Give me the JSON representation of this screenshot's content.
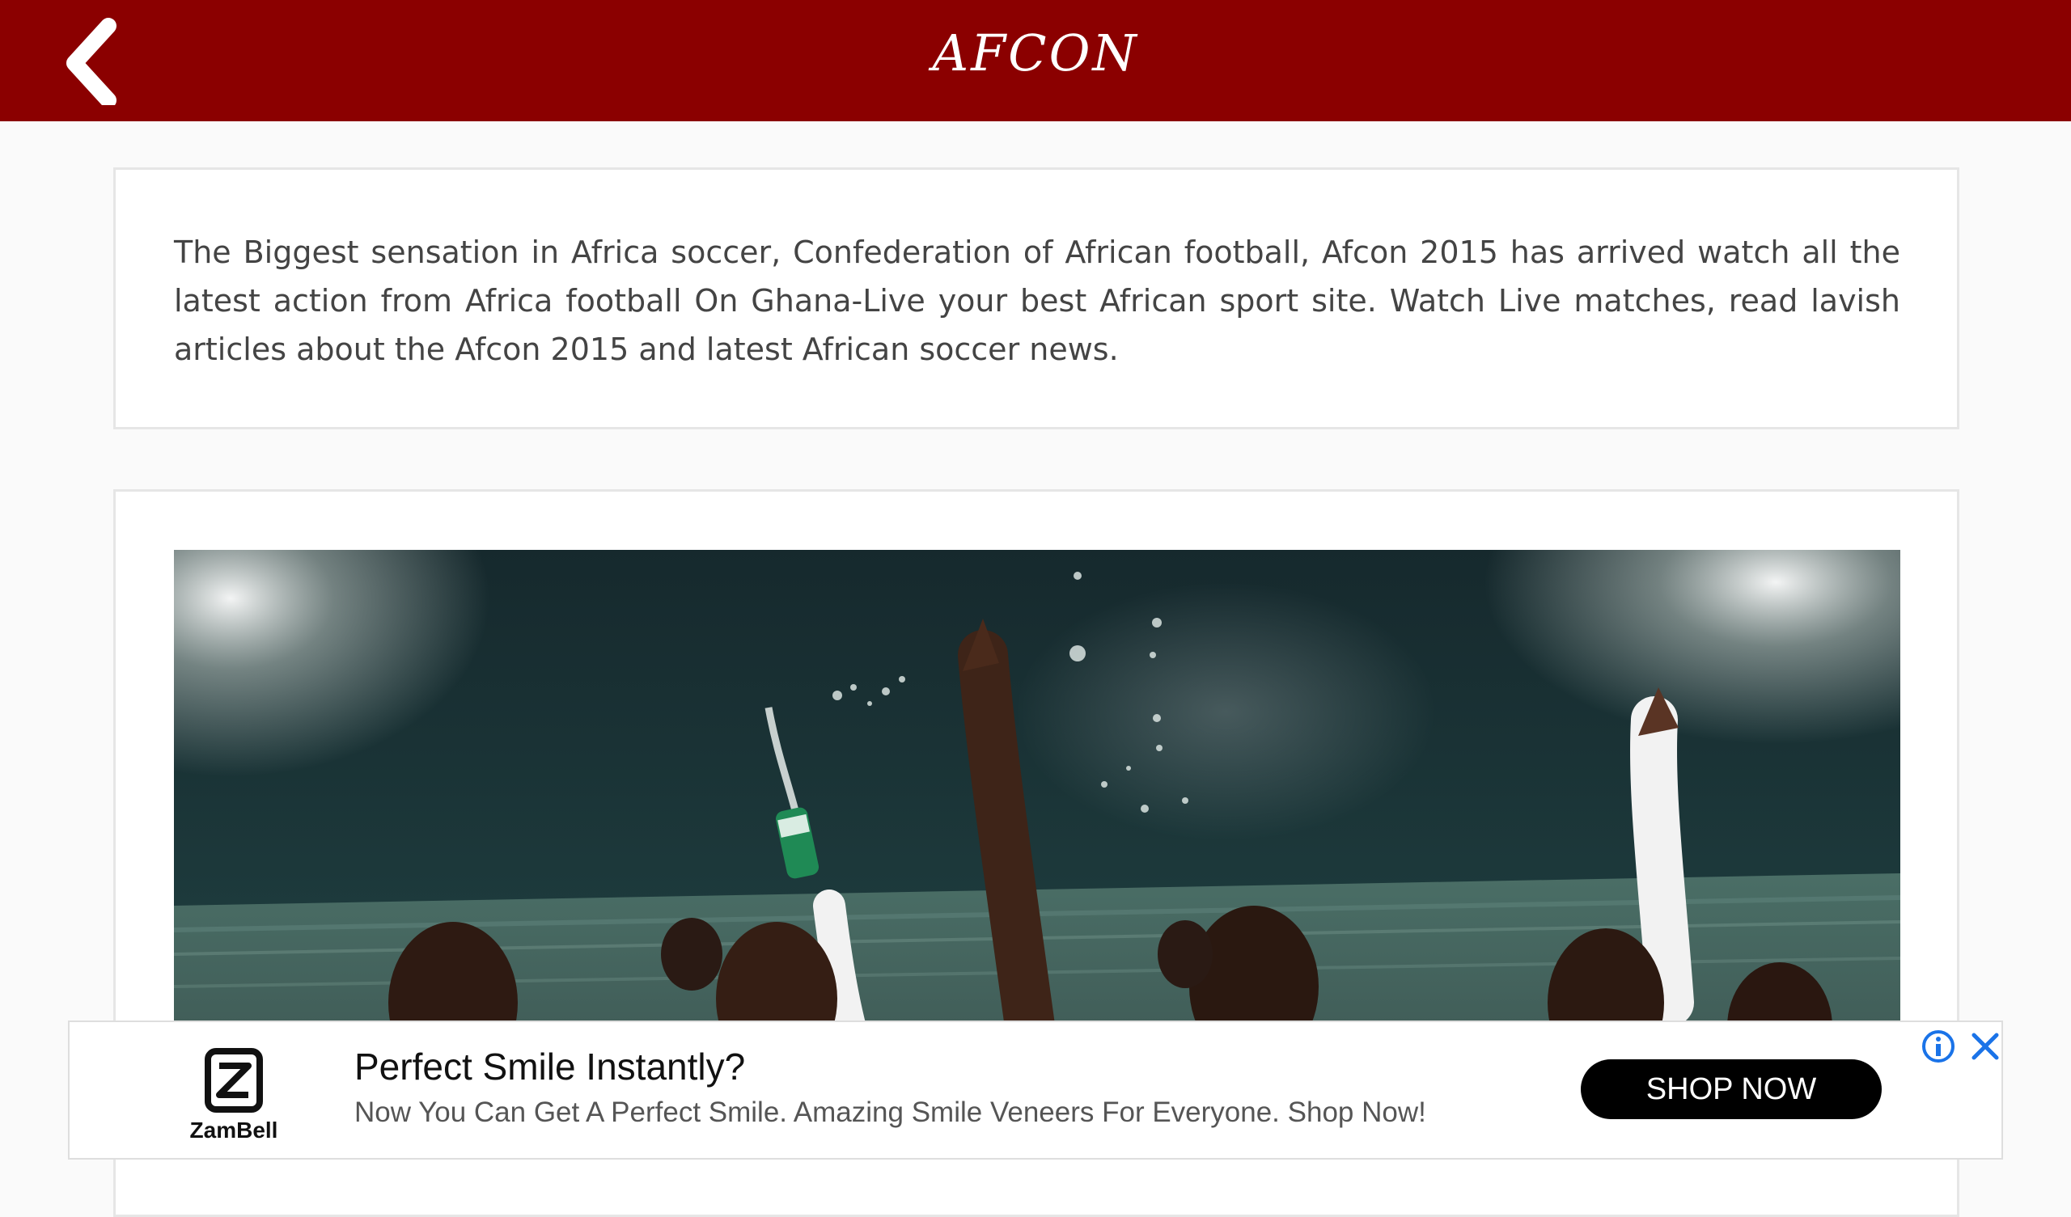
{
  "header": {
    "title": "AFCON",
    "back_icon": "chevron-left-icon",
    "background_color": "#8b0000"
  },
  "intro": {
    "text": "The Biggest sensation in Africa soccer, Confederation of African football, Afcon 2015 has arrived watch all the latest action from Africa football On Ghana-Live your best African sport site. Watch Live matches, read lavish articles about the Afcon 2015 and latest African soccer news."
  },
  "feature_image": {
    "subject": "Ghana players celebrating in a floodlit stadium"
  },
  "ad": {
    "brand": "ZamBell",
    "headline": "Perfect Smile Instantly?",
    "body": "Now You Can Get A Perfect Smile. Amazing Smile Veneers For Everyone. Shop Now!",
    "cta_label": "SHOP NOW",
    "info_icon": "info-icon",
    "close_icon": "close-icon",
    "accent_color": "#1a73e8"
  }
}
